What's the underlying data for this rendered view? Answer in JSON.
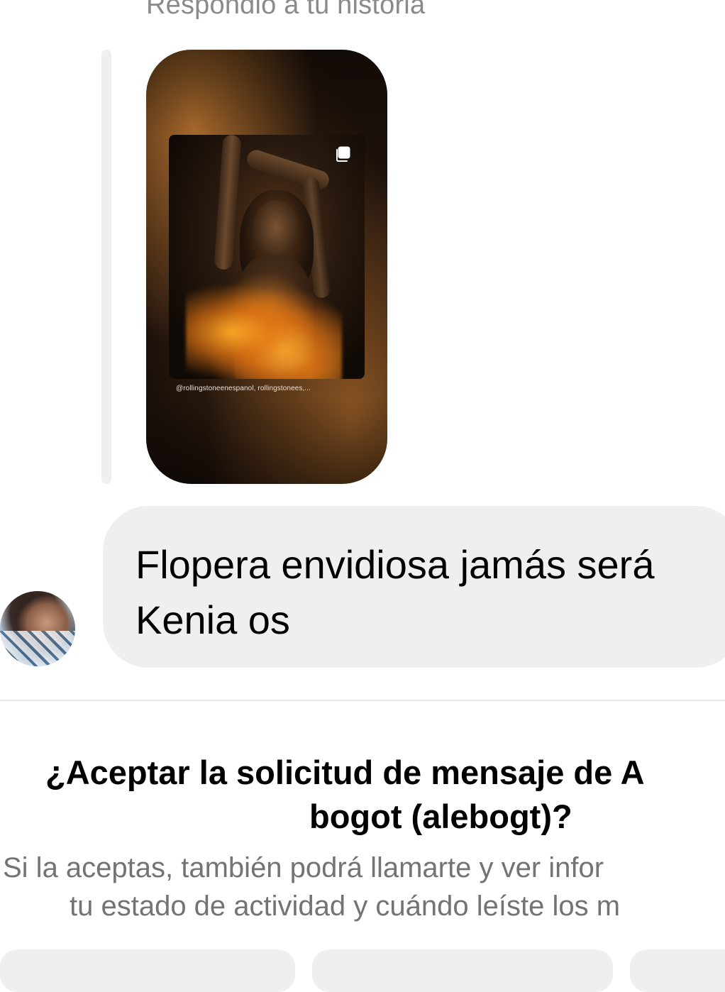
{
  "reply": {
    "label": "Respondió a tu historia"
  },
  "story": {
    "handle": "@rollingstoneenespanol, rollingstonees,...",
    "icon": "multiple-photos-icon"
  },
  "message": {
    "line1": "Flopera envidiosa jamás será",
    "line2": "Kenia os",
    "avatar_icon": "user-avatar"
  },
  "request": {
    "title_line1": "¿Aceptar la solicitud de mensaje de A",
    "title_line2": "bogot (alebogt)?",
    "desc_line1": "Si la aceptas, también podrá llamarte y ver infor",
    "desc_line2": "tu estado de actividad y cuándo leíste los m"
  },
  "buttons": [
    {
      "label": ""
    },
    {
      "label": ""
    },
    {
      "label": ""
    }
  ],
  "colors": {
    "bubble_bg": "#efefef",
    "secondary_text": "#737373",
    "reply_label": "#8a8a8a",
    "divider": "#e6e6e6"
  }
}
